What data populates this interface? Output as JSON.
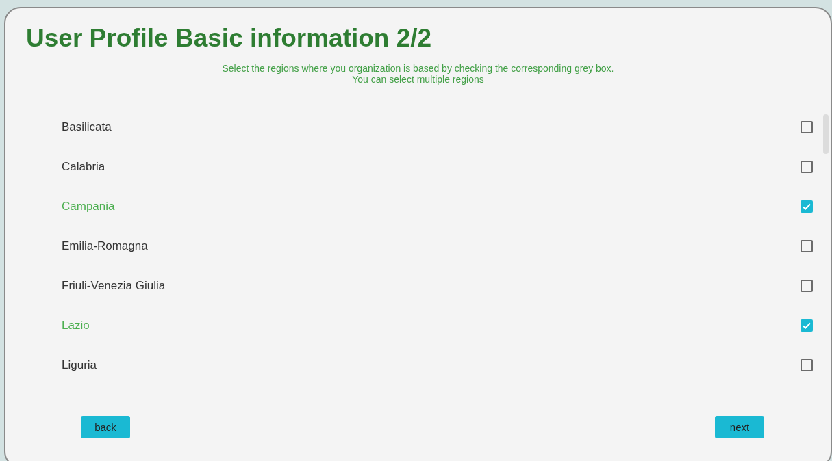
{
  "title": "User Profile Basic information 2/2",
  "instructions": [
    "Select the regions where you organization is based by checking the corresponding grey box.",
    "You can select multiple regions"
  ],
  "regions": [
    {
      "name": "Basilicata",
      "checked": false
    },
    {
      "name": "Calabria",
      "checked": false
    },
    {
      "name": "Campania",
      "checked": true
    },
    {
      "name": "Emilia-Romagna",
      "checked": false
    },
    {
      "name": "Friuli-Venezia Giulia",
      "checked": false
    },
    {
      "name": "Lazio",
      "checked": true
    },
    {
      "name": "Liguria",
      "checked": false
    }
  ],
  "buttons": {
    "back": "back",
    "next": "next"
  }
}
